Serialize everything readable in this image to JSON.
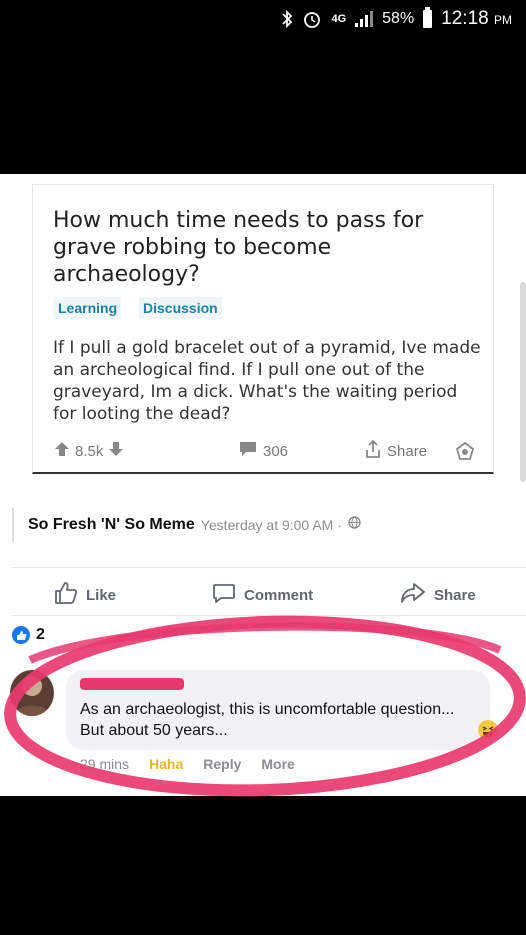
{
  "status_bar": {
    "network": "4G",
    "battery": "58%",
    "time": "12:18",
    "ampm": "PM"
  },
  "reddit_post": {
    "title": "How much time needs to pass for grave robbing to become archaeology?",
    "flairs": [
      "Learning",
      "Discussion"
    ],
    "body": "If I pull a gold bracelet out of a pyramid, Ive made an archeological find.  If I pull one out of the graveyard, Im a dick.  What's the waiting period for looting the dead?",
    "upvotes": "8.5k",
    "comments": "306",
    "share_label": "Share"
  },
  "attribution": {
    "page_name": "So Fresh 'N' So Meme",
    "time": "Yesterday at 9:00 AM · "
  },
  "actions": {
    "like": "Like",
    "comment": "Comment",
    "share": "Share"
  },
  "reactions": {
    "count": "2"
  },
  "comment": {
    "text": "As an archaeologist, this is uncomfortable question... But about 50 years...",
    "time": "29 mins",
    "haha": "Haha",
    "reply": "Reply",
    "more": "More"
  },
  "colors": {
    "facebook_blue": "#1877f2",
    "annotation_pink": "#e8396e",
    "flair_blue": "#1f7fa5"
  }
}
